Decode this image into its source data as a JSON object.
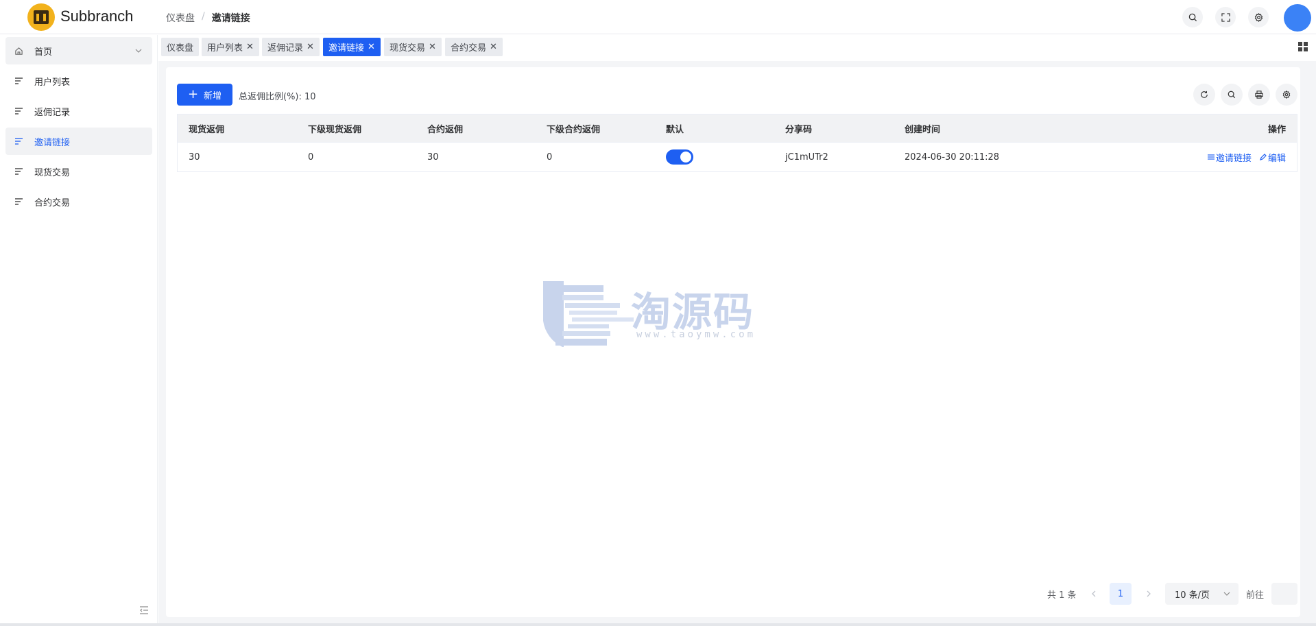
{
  "app": {
    "name": "Subbranch"
  },
  "breadcrumb": {
    "root": "仪表盘",
    "separator": "/",
    "current": "邀请链接"
  },
  "header_icons": [
    "search-icon",
    "fullscreen-icon",
    "settings-icon"
  ],
  "sidebar": {
    "items": [
      {
        "label": "首页",
        "icon": "home-icon"
      },
      {
        "label": "用户列表",
        "icon": "menu-lines-icon"
      },
      {
        "label": "返佣记录",
        "icon": "menu-lines-icon"
      },
      {
        "label": "邀请链接",
        "icon": "menu-lines-icon",
        "active": true
      },
      {
        "label": "现货交易",
        "icon": "menu-lines-icon"
      },
      {
        "label": "合约交易",
        "icon": "menu-lines-icon"
      }
    ]
  },
  "tabs": [
    {
      "label": "仪表盘"
    },
    {
      "label": "用户列表"
    },
    {
      "label": "返佣记录"
    },
    {
      "label": "邀请链接",
      "active": true
    },
    {
      "label": "现货交易"
    },
    {
      "label": "合约交易"
    }
  ],
  "toolbar": {
    "add_label": "新增",
    "ratio_label": "总返佣比例(%)",
    "ratio_value": "10"
  },
  "table": {
    "headers": [
      "现货返佣",
      "下级现货返佣",
      "合约返佣",
      "下级合约返佣",
      "默认",
      "分享码",
      "创建时间",
      "操作"
    ],
    "rows": [
      {
        "spot": "30",
        "sub_spot": "0",
        "contract": "30",
        "sub_contract": "0",
        "default": true,
        "share_code": "jC1mUTr2",
        "created": "2024-06-30 20:11:28",
        "actions": [
          "邀请链接",
          "编辑"
        ]
      }
    ]
  },
  "watermark": {
    "title": "淘源码",
    "url": "www.taoymw.com"
  },
  "pagination": {
    "total_label": "共 1 条",
    "current_page": "1",
    "page_size": "10 条/页",
    "goto_label": "前往"
  },
  "colors": {
    "primary": "#1e5ff2",
    "logo": "#f2b21c"
  }
}
